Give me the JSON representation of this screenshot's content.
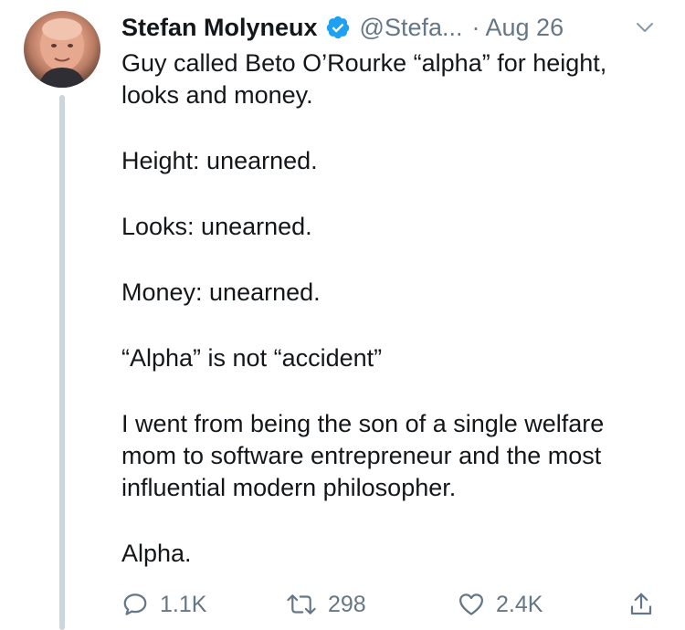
{
  "author": {
    "name": "Stefan Molyneux",
    "handle": "@Stefa...",
    "separator": "·",
    "date": "Aug 26",
    "verified": true
  },
  "tweet": {
    "paragraphs": [
      [
        "Guy called Beto O’Rourke “alpha” for height,",
        "looks and money."
      ],
      [
        "Height: unearned."
      ],
      [
        "Looks: unearned."
      ],
      [
        "Money: unearned."
      ],
      [
        "“Alpha” is not “accident”"
      ],
      [
        "I went from being the son of a single welfare",
        "mom to software entrepreneur and the most",
        "influential modern philosopher."
      ],
      [
        "Alpha."
      ]
    ]
  },
  "actions": {
    "reply": {
      "icon": "reply-icon",
      "count": "1.1K"
    },
    "retweet": {
      "icon": "retweet-icon",
      "count": "298"
    },
    "like": {
      "icon": "heart-icon",
      "count": "2.4K"
    },
    "share": {
      "icon": "share-icon"
    }
  },
  "colors": {
    "text": "#14171a",
    "muted": "#657786",
    "verified": "#1da1f2",
    "thread_line": "#ccd6dd"
  }
}
